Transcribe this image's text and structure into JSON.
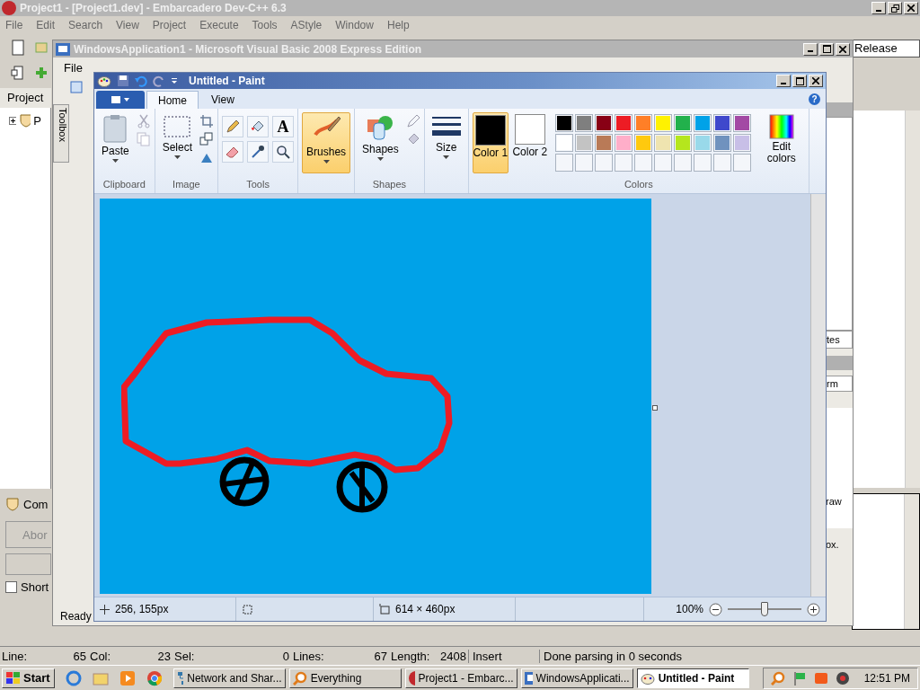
{
  "devcpp": {
    "title": "Project1 - [Project1.dev] - Embarcadero Dev-C++ 6.3",
    "menu": [
      "File",
      "Edit",
      "Search",
      "View",
      "Project",
      "Execute",
      "Tools",
      "AStyle",
      "Window",
      "Help"
    ],
    "config": "Release",
    "project_tab": "Project",
    "tree": [
      {
        "label": "P",
        "expanded": false
      }
    ],
    "compiler_tab": "Com",
    "abort_button": "Abor",
    "short_option": {
      "label": "Short",
      "checked": false
    },
    "status": [
      {
        "label": "Line:",
        "value": "65"
      },
      {
        "label": "Col:",
        "value": "23"
      },
      {
        "label": "Sel:",
        "value": "0"
      },
      {
        "label": "Lines:",
        "value": "67"
      },
      {
        "label": "Length:",
        "value": "2408"
      }
    ],
    "mode": "Insert",
    "message": "Done parsing in 0 seconds"
  },
  "vb": {
    "title": "WindowsApplication1 - Microsoft Visual Basic 2008 Express Edition",
    "menu": [
      "File"
    ],
    "toolbox": "Toolbox",
    "panel_tab": "tes",
    "dropdown": "rm",
    "grid_cell": "raw",
    "hint": "ox.",
    "status": "Ready"
  },
  "paint": {
    "title": "Untitled - Paint",
    "tabs": [
      {
        "label": "Home",
        "selected": true
      },
      {
        "label": "View",
        "selected": false
      }
    ],
    "help": "?",
    "paste": "Paste",
    "clipboard_label": "Clipboard",
    "select": "Select",
    "image_label": "Image",
    "text_tool": "A",
    "tools_label": "Tools",
    "brushes": {
      "label": "Brushes",
      "selected": true
    },
    "shapes": "Shapes",
    "shapes_label": "Shapes",
    "size": "Size",
    "color1": {
      "label": "Color 1",
      "color": "#000000",
      "selected": true
    },
    "color2": {
      "label": "Color 2",
      "color": "#ffffff",
      "selected": false
    },
    "palette": [
      {
        "color": "#000000"
      },
      {
        "color": "#7f7f7f"
      },
      {
        "color": "#880015"
      },
      {
        "color": "#ed1c24"
      },
      {
        "color": "#ff7f27"
      },
      {
        "color": "#fff200"
      },
      {
        "color": "#22b14c"
      },
      {
        "color": "#00a2e8"
      },
      {
        "color": "#3f48cc"
      },
      {
        "color": "#a349a4"
      },
      {
        "color": "#ffffff"
      },
      {
        "color": "#c3c3c3"
      },
      {
        "color": "#b97a57"
      },
      {
        "color": "#ffaec9"
      },
      {
        "color": "#ffc90e"
      },
      {
        "color": "#efe4b0"
      },
      {
        "color": "#b5e61d"
      },
      {
        "color": "#99d9ea"
      },
      {
        "color": "#7092be"
      },
      {
        "color": "#c8bfe7"
      }
    ],
    "edit_colors": "Edit colors",
    "colors_label": "Colors",
    "position": "256, 155px",
    "dimensions": "614 × 460px",
    "zoom": "100%",
    "zoom_slider": {
      "level": 0.5
    }
  },
  "taskbar": {
    "start": "Start",
    "tasks": [
      {
        "label": "Network and Shar...",
        "kind": "network",
        "selected": false
      },
      {
        "label": "Everything",
        "kind": "search",
        "selected": false
      },
      {
        "label": "Project1 - Embarc...",
        "kind": "devcpp",
        "selected": false
      },
      {
        "label": "WindowsApplicati...",
        "kind": "vb",
        "selected": false
      },
      {
        "label": "Untitled - Paint",
        "kind": "paint",
        "selected": true
      }
    ],
    "clock": "12:51 PM"
  }
}
